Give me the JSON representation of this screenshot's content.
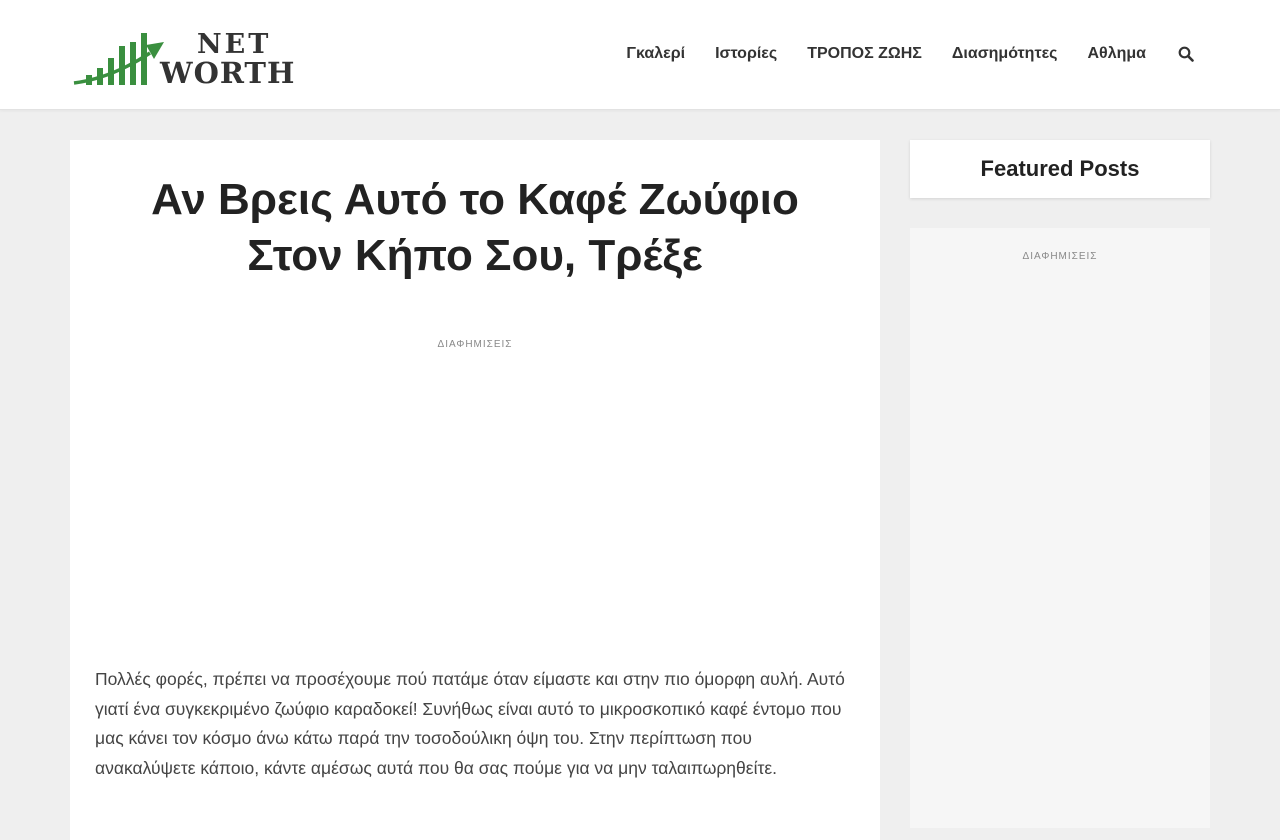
{
  "site": {
    "logo_line1": "NET",
    "logo_line2": "WORTH",
    "logo_icon": "growth-chart-arrow-icon",
    "logo_green": "#3a8f3f"
  },
  "nav": {
    "items": [
      {
        "label": "Γκαλερί"
      },
      {
        "label": "Ιστορίες"
      },
      {
        "label": "ΤΡΟΠΟΣ ΖΩΗΣ"
      },
      {
        "label": "Διασημότητες"
      },
      {
        "label": "Αθλημα"
      }
    ],
    "search_icon": "search-icon"
  },
  "article": {
    "title": "Αν Βρεις Αυτό το Καφέ Ζωύφιο Στον Κήπο Σου, Τρέξε",
    "ad_label": "ΔΙΑΦΗΜΙΣΕΙΣ",
    "body": "Πολλές φορές, πρέπει να προσέχουμε πού πατάμε όταν είμαστε και στην πιο όμορφη αυλή. Αυτό γιατί ένα συγκεκριμένο ζωύφιο καραδοκεί! Συνήθως είναι αυτό το μικροσκοπικό καφέ έντομο που μας κάνει τον κόσμο άνω κάτω παρά την τοσοδούλικη όψη του. Στην περίπτωση που ανακαλύψετε κάποιο, κάντε αμέσως αυτά που θα σας πούμε για να μην ταλαιπωρηθείτε."
  },
  "sidebar": {
    "featured_title": "Featured Posts",
    "ad_label": "ΔΙΑΦΗΜΙΣΕΙΣ"
  }
}
